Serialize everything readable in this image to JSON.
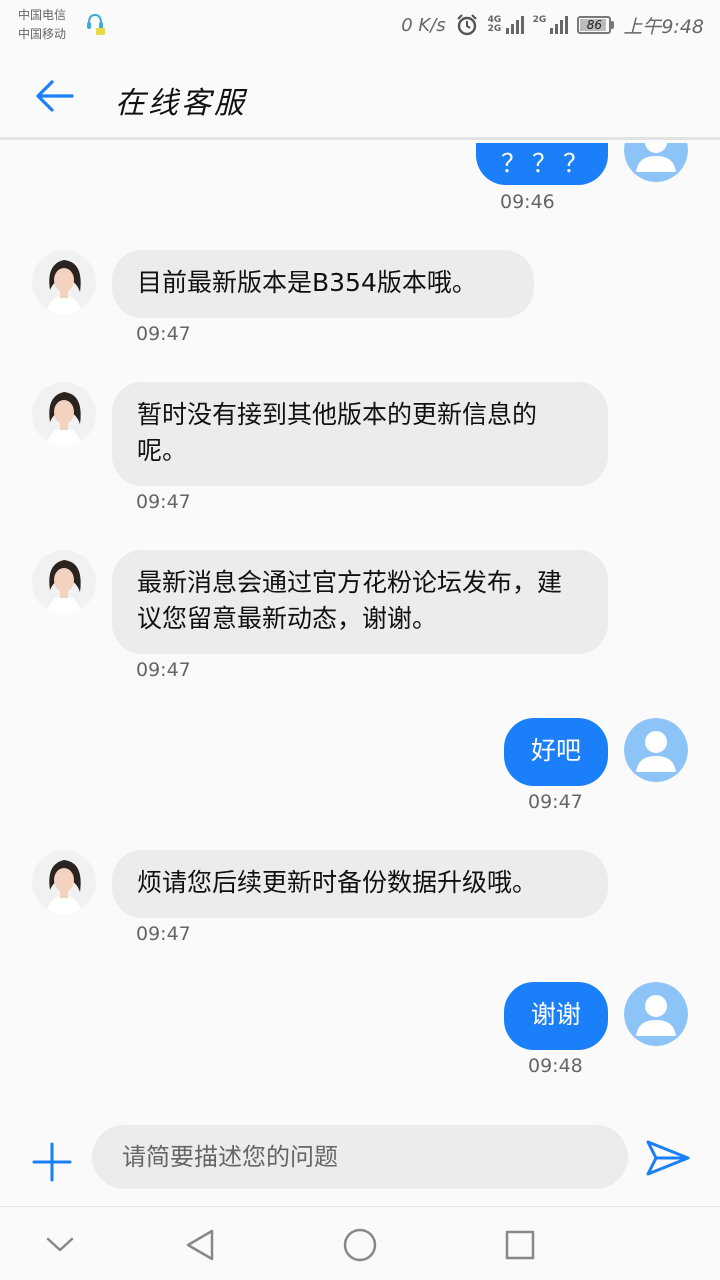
{
  "status_bar": {
    "carrier_1": "中国电信",
    "carrier_2": "中国移动",
    "net_speed": "0 K/s",
    "signal_1": "4G 2G",
    "signal_2": "2G",
    "battery": "86",
    "clock": "上午9:48"
  },
  "header": {
    "title": "在线客服",
    "back_icon": "arrow-left-icon"
  },
  "messages": [
    {
      "from": "me",
      "text": "？？？",
      "time": "09:46"
    },
    {
      "from": "agent",
      "text": "目前最新版本是B354版本哦。",
      "time": "09:47"
    },
    {
      "from": "agent",
      "text": "暂时没有接到其他版本的更新信息的呢。",
      "time": "09:47"
    },
    {
      "from": "agent",
      "text": "最新消息会通过官方花粉论坛发布，建议您留意最新动态，谢谢。",
      "time": "09:47"
    },
    {
      "from": "me",
      "text": "好吧",
      "time": "09:47"
    },
    {
      "from": "agent",
      "text": "烦请您后续更新时备份数据升级哦。",
      "time": "09:47"
    },
    {
      "from": "me",
      "text": "谢谢",
      "time": "09:48"
    }
  ],
  "input": {
    "placeholder": "请简要描述您的问题",
    "value": ""
  },
  "colors": {
    "accent": "#1a7ff8",
    "agent_bubble": "#ececee",
    "user_avatar": "#8cc4f7"
  }
}
